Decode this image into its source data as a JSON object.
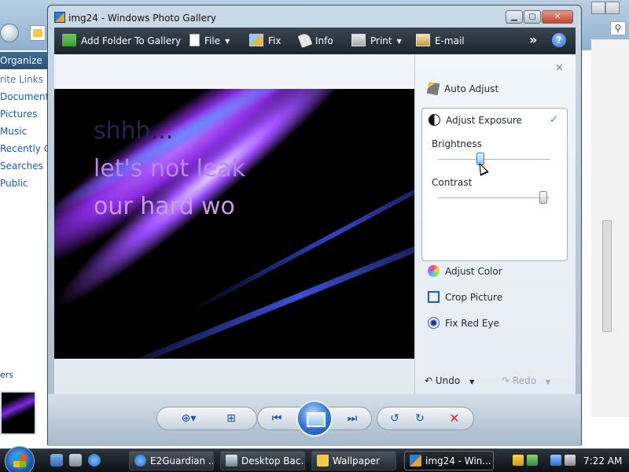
{
  "explorer": {
    "organize": "Organize",
    "sidebar": [
      "rite Links",
      "Documents",
      "Pictures",
      "Music",
      "Recently Ch",
      "Searches",
      "Public"
    ],
    "folders": "ers"
  },
  "window": {
    "title": "img24 - Windows Photo Gallery"
  },
  "toolbar": {
    "add_folder": "Add Folder To Gallery",
    "file": "File",
    "fix": "Fix",
    "info": "Info",
    "print": "Print",
    "email": "E-mail",
    "more": "»",
    "help": "?"
  },
  "photo": {
    "lines": [
      "shhh...",
      "let's not leak",
      "our hard wo"
    ]
  },
  "panel": {
    "close": "×",
    "auto_adjust": "Auto Adjust",
    "adjust_exposure": "Adjust Exposure",
    "check": "✓",
    "brightness_label": "Brightness",
    "brightness_value": 0.37,
    "contrast_label": "Contrast",
    "contrast_value": 0.98,
    "adjust_color": "Adjust Color",
    "crop_picture": "Crop Picture",
    "fix_red_eye": "Fix Red Eye",
    "undo": "Undo",
    "redo": "Redo"
  },
  "taskbar": {
    "items": [
      "E2Guardian ...",
      "Desktop Bac...",
      "Wallpaper",
      "img24 - Win..."
    ],
    "clock": "7:22 AM"
  },
  "colors": {
    "toolbar_bg": "#1c252e",
    "accent": "#2f73d4",
    "delete": "#d2262c",
    "check": "#3c9a46"
  }
}
